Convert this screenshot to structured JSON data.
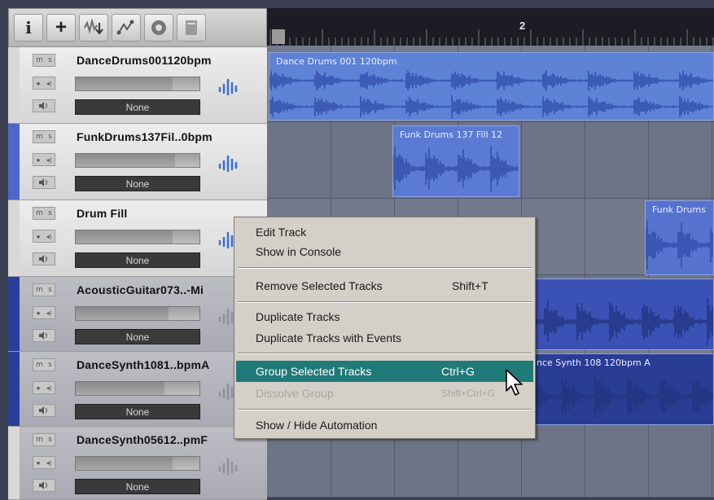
{
  "toolbar": {
    "buttons": [
      {
        "icon": "info-icon",
        "glyph": "i"
      },
      {
        "icon": "add-icon",
        "glyph": "+"
      },
      {
        "icon": "import-audio-icon",
        "glyph": ""
      },
      {
        "icon": "loop-browser-icon",
        "glyph": ""
      },
      {
        "icon": "media-icon",
        "glyph": ""
      },
      {
        "icon": "notepad-icon",
        "glyph": ""
      }
    ]
  },
  "ruler": {
    "bar_label": "2"
  },
  "tracks": [
    {
      "name": "DanceDrums001120bpm",
      "route": "None",
      "color": "#d8d8d8",
      "volume": 0.78,
      "dim": false
    },
    {
      "name": "FunkDrums137Fil..0bpm",
      "route": "None",
      "color": "#4f66c9",
      "volume": 0.8,
      "dim": false
    },
    {
      "name": "Drum Fill",
      "route": "None",
      "color": "#d8d8d8",
      "volume": 0.78,
      "dim": false
    },
    {
      "name": "AcousticGuitar073..-Mi",
      "route": "None",
      "color": "#2b3f9a",
      "volume": 0.75,
      "dim": true
    },
    {
      "name": "DanceSynth1081..bpmA",
      "route": "None",
      "color": "#2a3e98",
      "volume": 0.72,
      "dim": true
    },
    {
      "name": "DanceSynth05612..pmF",
      "route": "None",
      "color": "#d8d8d8",
      "volume": 0.78,
      "dim": true
    }
  ],
  "track_buttons": {
    "mute": "m",
    "solo": "s",
    "record": "●",
    "monitor": "◂)"
  },
  "clips": [
    {
      "label": "Dance Drums 001 120bpm",
      "color": "#5d82d6"
    },
    {
      "label": "Funk Drums 137 Fill 12",
      "color": "#5a7ad4"
    },
    {
      "label": "Funk Drums",
      "color": "#5573cf"
    },
    {
      "label": "",
      "color": "#3a52b6"
    },
    {
      "label": "nce Synth 108 120bpm A",
      "color": "#2a3d95"
    }
  ],
  "context_menu": {
    "items": [
      {
        "label": "Edit Track",
        "shortcut": "",
        "state": "normal"
      },
      {
        "label": "Show in Console",
        "shortcut": "",
        "state": "normal"
      },
      {
        "label": "Remove Selected Tracks",
        "shortcut": "Shift+T",
        "state": "normal"
      },
      {
        "label": "Duplicate Tracks",
        "shortcut": "",
        "state": "normal"
      },
      {
        "label": "Duplicate Tracks with Events",
        "shortcut": "",
        "state": "normal"
      },
      {
        "label": "Group Selected Tracks",
        "shortcut": "Ctrl+G",
        "state": "highlighted"
      },
      {
        "label": "Dissolve Group",
        "shortcut": "Shift+Ctrl+G",
        "state": "disabled"
      },
      {
        "label": "Show / Hide Automation",
        "shortcut": "",
        "state": "normal"
      }
    ]
  },
  "colors": {
    "highlight": "#1f7a78",
    "clip_blue": "#5f7fd1",
    "arrange_bg": "#6c7385"
  }
}
